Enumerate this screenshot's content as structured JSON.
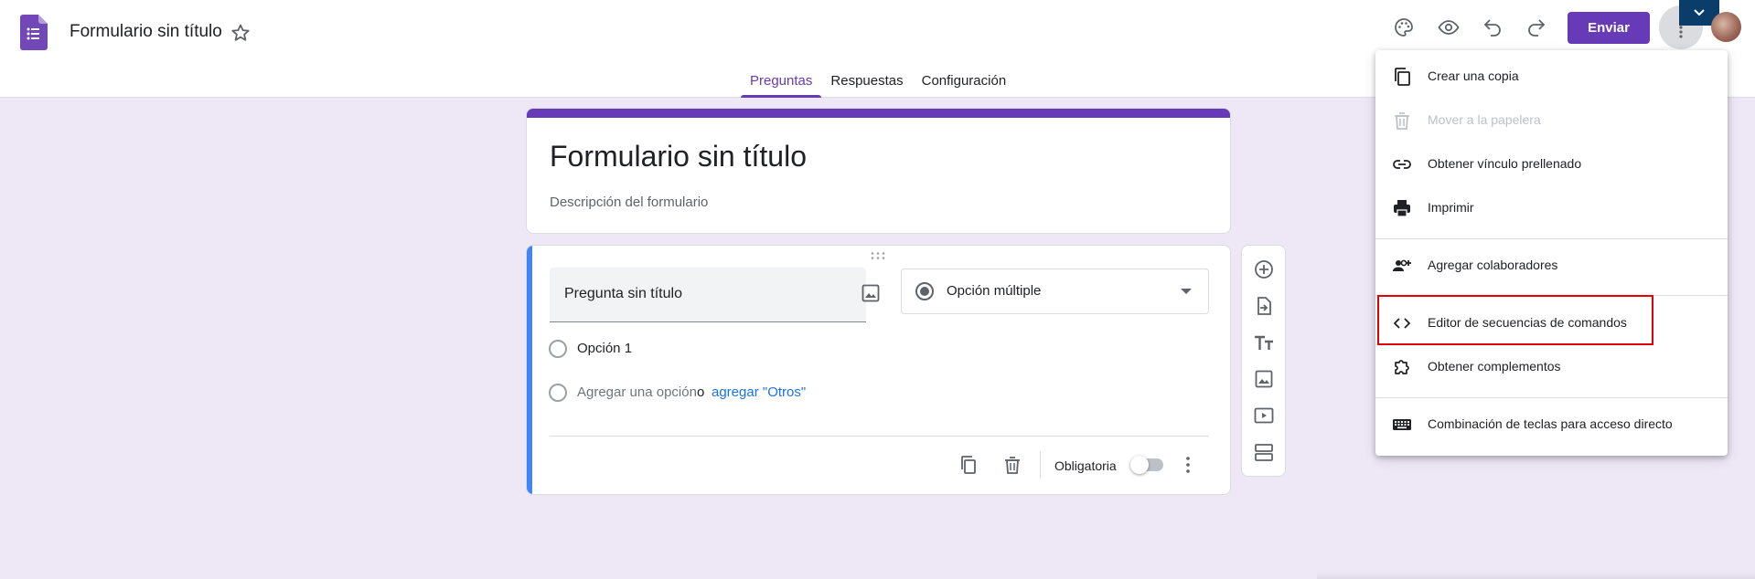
{
  "app": {
    "document_title": "Formulario sin título",
    "send_label": "Enviar",
    "accent_color": "#673ab7"
  },
  "tabs": [
    {
      "label": "Preguntas",
      "active": true
    },
    {
      "label": "Respuestas",
      "active": false
    },
    {
      "label": "Configuración",
      "active": false
    }
  ],
  "form": {
    "title": "Formulario sin título",
    "description_placeholder": "Descripción del formulario"
  },
  "question": {
    "title": "Pregunta sin título",
    "type": "Opción múltiple",
    "option1": "Opción 1",
    "add_option": "Agregar una opción",
    "or": "o",
    "add_other": "agregar \"Otros\"",
    "required_label": "Obligatoria",
    "required": false
  },
  "side_toolbar": [
    "add-question-icon",
    "import-questions-icon",
    "add-title-icon",
    "add-image-icon",
    "add-video-icon",
    "add-section-icon"
  ],
  "menu": {
    "items": [
      {
        "label": "Crear una copia",
        "icon": "copy-icon",
        "enabled": true
      },
      {
        "label": "Mover a la papelera",
        "icon": "trash-icon",
        "enabled": false
      },
      {
        "label": "Obtener vínculo prellenado",
        "icon": "link-icon",
        "enabled": true
      },
      {
        "label": "Imprimir",
        "icon": "print-icon",
        "enabled": true
      },
      {
        "label": "Agregar colaboradores",
        "icon": "add-people-icon",
        "enabled": true
      },
      {
        "label": "Editor de secuencias de comandos",
        "icon": "code-icon",
        "enabled": true,
        "highlighted": true
      },
      {
        "label": "Obtener complementos",
        "icon": "puzzle-icon",
        "enabled": true
      },
      {
        "label": "Combinación de teclas para acceso directo",
        "icon": "keyboard-icon",
        "enabled": true
      }
    ],
    "highlight_color": "#e00000"
  }
}
